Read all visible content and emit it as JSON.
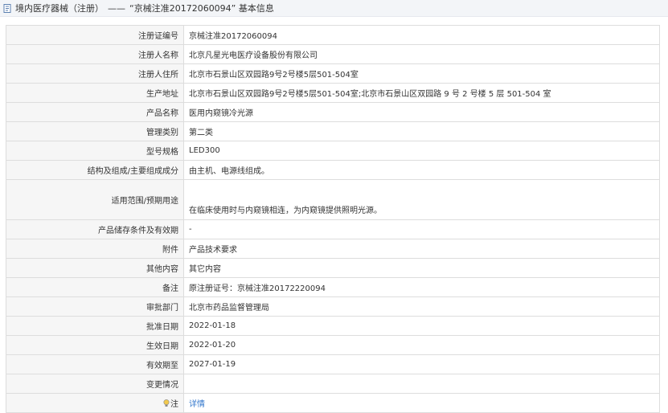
{
  "header": {
    "section": "境内医疗器械（注册）",
    "separator": "——",
    "record_title": "“京械注准20172060094” 基本信息"
  },
  "colors": {
    "header_bg": "#f3f5f8",
    "label_bg": "#f6f6f6",
    "border": "#dddddd",
    "link": "#3377cc"
  },
  "rows": [
    {
      "label": "注册证编号",
      "value": "京械注准20172060094"
    },
    {
      "label": "注册人名称",
      "value": "北京凡星光电医疗设备股份有限公司"
    },
    {
      "label": "注册人住所",
      "value": "北京市石景山区双园路9号2号楼5层501-504室"
    },
    {
      "label": "生产地址",
      "value": "北京市石景山区双园路9号2号楼5层501-504室;北京市石景山区双园路 9 号 2 号楼 5 层 501-504 室"
    },
    {
      "label": "产品名称",
      "value": "医用内窥镜冷光源"
    },
    {
      "label": "管理类别",
      "value": "第二类"
    },
    {
      "label": "型号规格",
      "value": "LED300"
    },
    {
      "label": "结构及组成/主要组成成分",
      "value": "由主机、电源线组成。"
    },
    {
      "label": "适用范围/预期用途",
      "value": "在临床使用时与内窥镜相连，为内窥镜提供照明光源。"
    },
    {
      "label": "产品储存条件及有效期",
      "value": "-"
    },
    {
      "label": "附件",
      "value": "产品技术要求"
    },
    {
      "label": "其他内容",
      "value": "其它内容"
    },
    {
      "label": "备注",
      "value": "原注册证号：京械注准20172220094"
    },
    {
      "label": "审批部门",
      "value": "北京市药品监督管理局"
    },
    {
      "label": "批准日期",
      "value": "2022-01-18"
    },
    {
      "label": "生效日期",
      "value": "2022-01-20"
    },
    {
      "label": "有效期至",
      "value": "2027-01-19"
    },
    {
      "label": "变更情况",
      "value": ""
    }
  ],
  "note": {
    "icon": "lightbulb-icon",
    "label": "注",
    "link_text": "详情"
  }
}
